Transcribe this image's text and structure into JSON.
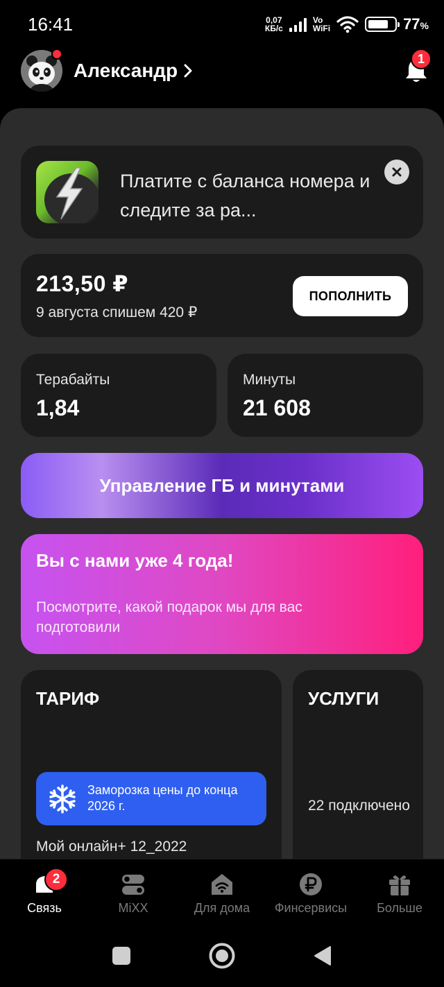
{
  "status_bar": {
    "time": "16:41",
    "speed_value": "0,07",
    "speed_unit": "КБ/с",
    "vo_line1": "Vo",
    "vo_line2": "WiFi",
    "battery_percent": "77",
    "battery_level": 0.77
  },
  "header": {
    "user_name": "Александр",
    "notification_count": "1"
  },
  "promo": {
    "text": "Платите с баланса номера и следите за ра..."
  },
  "balance": {
    "amount": "213,50 ₽",
    "next_charge": "9 августа спишем 420 ₽",
    "topup_label": "ПОПОЛНИТЬ"
  },
  "stats": {
    "data_label": "Терабайты",
    "data_value": "1,84",
    "minutes_label": "Минуты",
    "minutes_value": "21 608"
  },
  "manage_label": "Управление ГБ и минутами",
  "anniversary": {
    "title": "Вы с нами уже 4 года!",
    "text": "Посмотрите, какой подарок мы для вас подготовили"
  },
  "tariff": {
    "title": "ТАРИФ",
    "freeze_text": "Заморозка цены до конца 2026 г.",
    "name": "Мой онлайн+ 12_2022"
  },
  "services": {
    "title": "УСЛУГИ",
    "count_text": "22 подключено"
  },
  "tabs": [
    {
      "label": "Связь",
      "icon": "phone-icon",
      "badge": "2",
      "active": true
    },
    {
      "label": "MiXX",
      "icon": "toggles-icon"
    },
    {
      "label": "Для дома",
      "icon": "home-wifi-icon"
    },
    {
      "label": "Финсервисы",
      "icon": "ruble-coin-icon"
    },
    {
      "label": "Больше",
      "icon": "gift-icon"
    }
  ],
  "colors": {
    "background": "#000000",
    "sheet": "#2c2c2c",
    "card": "#1b1b1b",
    "badge_red": "#ff2d3b",
    "freeze_blue": "#2f5ff0",
    "anniversary_pink": "#ff1f7c",
    "manage_purple": "#6a2fc9"
  }
}
